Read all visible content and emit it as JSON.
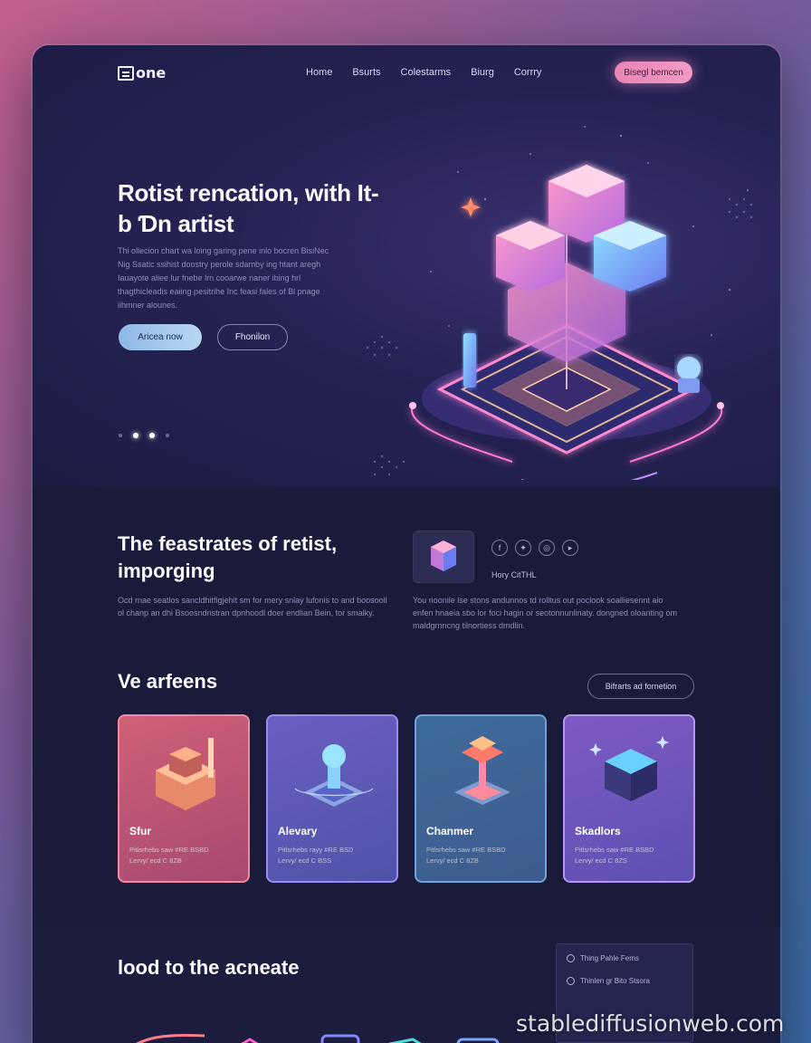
{
  "nav": {
    "logo": "one",
    "links": [
      "Home",
      "Bsurts",
      "Colestarms",
      "Biurg",
      "Corrry"
    ],
    "cta": "Bisegl bemcen"
  },
  "hero": {
    "title": "Rotist rencation, with It-b Ɗn artist",
    "body": "Thi ollecion chart wa loing garing pene inlo bocren BisiNec Nig Ssatic ssihist doostry perole sdamby ing htant aregh Iauayote aliee lur fnebe lrn cooarwe naner ibing hrl thagthicleadis eaiing pesitrihe Inc feasi fales of Bl pnage iihmner alounes.",
    "primary_button": "Aricea now",
    "secondary_button": "Fhonilon"
  },
  "features": {
    "title": "The feastrates of retist, imporging",
    "body_left": "Ocd rnae seatlos sancldhitfigjehit sm for mery snlay lufonis to and boosooll ol chanp an dhi Bsoosndnstran dpnhoodl doer endlian Bein, tor smalky.",
    "byline": "Hory CitTHL",
    "body_right": "You rioonile lse stons andunnos td rolltus out poclook soalliesennt aio enfen hnaeia sbo lor foci hagin or seotonnunlinaty. dongned oloanting om maldgrnncng tilnortiess dmdlin.",
    "social_icons": [
      "f",
      "tw",
      "ig",
      "yt"
    ]
  },
  "section": {
    "title": "Ve arfeens",
    "button": "Bifrarts ad fornetion"
  },
  "cards": [
    {
      "title": "Sfur",
      "line1": "Pitlsrhebs saw #RE BSBD",
      "line2": "Lervy/ ecd C 8ZB"
    },
    {
      "title": "Alevary",
      "line1": "Pitlsrhebs rayy #RE BSD",
      "line2": "Lervy/ ecd C BSS"
    },
    {
      "title": "Chanmer",
      "line1": "Pitlsrhebs saw #RE BSBD",
      "line2": "Lervy/ ecd C 8ZB"
    },
    {
      "title": "Skadlors",
      "line1": "Pitlsrhebs saw #RE BSBD",
      "line2": "Lervy/ ecd C 8ZS"
    }
  ],
  "bottom": {
    "title": "lood to the acneate",
    "panel": [
      "Thing Pahle Fems",
      "Thinlen gr Bito Stsora"
    ]
  },
  "watermark": "stablediffusionweb.com",
  "colors": {
    "accent_pink": "#f29bc6",
    "accent_blue": "#b8d6f2",
    "background": "#1a1b3a"
  }
}
